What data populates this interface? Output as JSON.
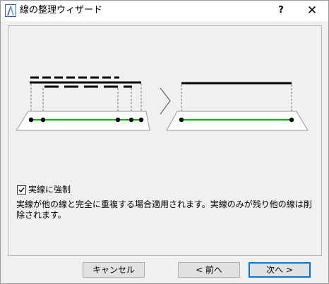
{
  "window": {
    "title": "線の整理ウィザード"
  },
  "titlebar": {
    "help_label": "?",
    "close_label": "✕"
  },
  "option": {
    "checkbox_label": "実線に強制",
    "checked": true
  },
  "description": "実線が他の線と完全に重複する場合適用されます。実線のみが残り他の線は削除されます。",
  "buttons": {
    "cancel": "キャンセル",
    "back": "< 前へ",
    "next": "次へ >"
  },
  "colors": {
    "green_line": "#00b000",
    "focus_border": "#0078d7"
  }
}
